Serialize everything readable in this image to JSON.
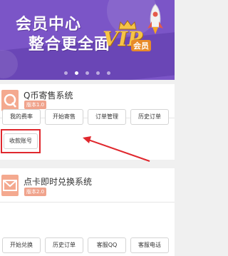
{
  "banner": {
    "title_line1": "会员中心",
    "title_line2": "整合更全面",
    "logo_text": "VIP",
    "logo_sub": "会员",
    "carousel_dots": 5,
    "active_dot": 1,
    "accent_color": "#7b55c7"
  },
  "qb_system": {
    "name": "Q币寄售系统",
    "version": "版本1.0",
    "icon": "qq-coin-icon",
    "buttons": [
      "我的费率",
      "开始寄售",
      "订单管理",
      "历史订单"
    ],
    "extra_button": "收款账号"
  },
  "dianka_system": {
    "name": "点卡即时兑换系统",
    "version": "版本2.0",
    "icon": "envelope-icon",
    "buttons": [
      "开始兑换",
      "历史订单",
      "客服QQ",
      "客服电话"
    ]
  },
  "annotation": {
    "highlight_color": "#e0282e"
  }
}
